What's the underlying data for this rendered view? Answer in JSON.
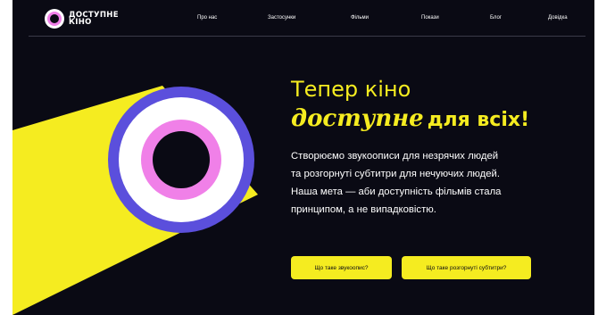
{
  "logo": {
    "line1": "ДОСТУПНЕ",
    "line2": "КІНО"
  },
  "nav": {
    "items": [
      {
        "label": "Про нас"
      },
      {
        "label": "Застосунки"
      },
      {
        "label": "Фільми"
      },
      {
        "label": "Покази"
      },
      {
        "label": "Блог"
      },
      {
        "label": "Довідка"
      }
    ]
  },
  "hero": {
    "headline_line1": "Тепер кіно",
    "headline_accent": "доступне",
    "headline_rest": "для всіх!",
    "description_lines": [
      "Створюємо звукоописи для незрячих людей",
      "та розгорнуті субтитри для нечуючих людей.",
      "Наша мета — аби доступність фільмів стала",
      "принципом, а не випадковістю."
    ],
    "button_primary": "Що таке звукоопис?",
    "button_secondary": "Що таке розгорнуті субтитри?"
  },
  "colors": {
    "background": "#0a0a14",
    "accent_yellow": "#f5ec20",
    "ring_blue": "#5b4fdc",
    "ring_pink": "#f080e8",
    "white": "#ffffff"
  }
}
